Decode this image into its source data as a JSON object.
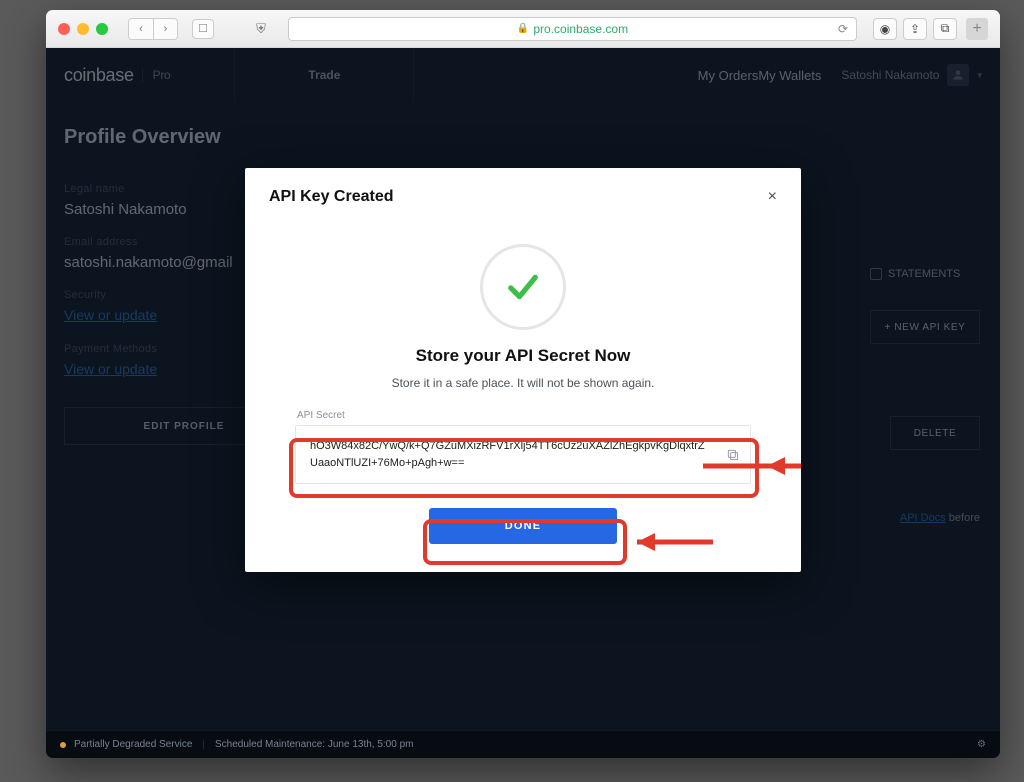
{
  "browser": {
    "url": "pro.coinbase.com"
  },
  "brand": {
    "name": "coinbase",
    "sub": "Pro"
  },
  "topnav": {
    "trade": "Trade",
    "orders": "My Orders",
    "wallets": "My Wallets"
  },
  "account": {
    "name": "Satoshi Nakamoto"
  },
  "profile": {
    "title": "Profile Overview",
    "legal_label": "Legal name",
    "legal_value": "Satoshi Nakamoto",
    "email_label": "Email address",
    "email_value": "satoshi.nakamoto@gmail",
    "security_label": "Security",
    "security_link": "View or update",
    "payment_label": "Payment Methods",
    "payment_link": "View or update",
    "edit_btn": "EDIT PROFILE"
  },
  "right": {
    "statements": "STATEMENTS",
    "new_key": "+ NEW API KEY",
    "delete": "DELETE",
    "docs_link": "API Docs",
    "docs_after": "before"
  },
  "status": {
    "text": "Partially Degraded Service",
    "maint": "Scheduled Maintenance: June 13th, 5:00 pm"
  },
  "modal": {
    "title": "API Key Created",
    "heading": "Store your API Secret Now",
    "sub": "Store it in a safe place. It will not be shown again.",
    "secret_label": "API Secret",
    "secret": "hO3W84x82C/YwQ/k+Q7GZuMXizRFV1rXlj54TT6cUz2uXAZlZhEgkpvKgDlqxtrZUaaoNTlUZI+76Mo+pAgh+w==",
    "done": "DONE"
  }
}
